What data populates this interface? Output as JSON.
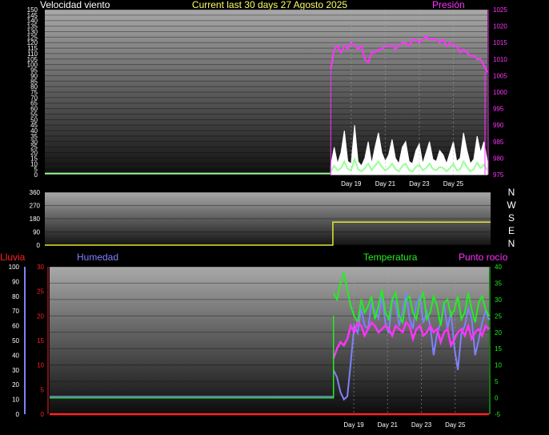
{
  "header": {
    "wind_label": "Velocidad viento",
    "title": "Current last 30 days 27 Agosto 2025",
    "pressure_label": "Presión"
  },
  "colors": {
    "wind_label": "#ffffff",
    "title": "#ffff66",
    "pressure": "#ff33ff",
    "wind_gust": "#ffffff",
    "wind_avg": "#99ff99",
    "wind_dir": "#e6e633",
    "rain": "#ff2222",
    "humidity": "#8080ff",
    "temperature": "#22ee22",
    "dew_point": "#ff33ff"
  },
  "compass_letters": [
    "N",
    "W",
    "S",
    "E",
    "N"
  ],
  "bottom_labels": {
    "rain": "Lluvia",
    "humidity": "Humedad",
    "temperature": "Temperatura",
    "dew_point": "Punto rocío"
  },
  "chart_data": [
    {
      "type": "line",
      "x_range": [
        "Day 1",
        "Day 27"
      ],
      "x_ticks": [
        "Day 19",
        "Day 21",
        "Day 23",
        "Day 25"
      ],
      "x_tick_days": [
        19,
        21,
        23,
        25
      ],
      "left_axis": {
        "ticks": [
          0,
          5,
          10,
          15,
          20,
          25,
          30,
          35,
          40,
          45,
          50,
          55,
          60,
          65,
          70,
          75,
          80,
          85,
          90,
          95,
          100,
          105,
          110,
          115,
          120,
          125,
          130,
          135,
          140,
          145,
          150
        ],
        "range": [
          0,
          150
        ]
      },
      "right_axis": {
        "ticks": [
          975,
          980,
          985,
          990,
          995,
          1000,
          1005,
          1010,
          1015,
          1020,
          1025
        ],
        "range": [
          975,
          1025
        ]
      },
      "series": [
        {
          "name": "Presión",
          "axis": "right",
          "start_day": 17.8,
          "values": [
            1007,
            1013,
            1014,
            1012,
            1014,
            1013,
            1015,
            1014,
            1013,
            1014,
            1010,
            1009,
            1012,
            1012,
            1013,
            1013,
            1014,
            1014,
            1014,
            1013,
            1014,
            1015,
            1015,
            1014,
            1016,
            1016,
            1015,
            1016,
            1017,
            1016,
            1016,
            1016,
            1015,
            1016,
            1014,
            1015,
            1014,
            1014,
            1012,
            1013,
            1012,
            1011,
            1011,
            1010,
            1010,
            1008,
            1006
          ]
        },
        {
          "axis": "left",
          "start_day": 17.8,
          "values": [
            8,
            25,
            10,
            20,
            40,
            12,
            10,
            45,
            12,
            8,
            15,
            30,
            10,
            25,
            38,
            20,
            12,
            18,
            32,
            15,
            10,
            25,
            30,
            12,
            10,
            22,
            28,
            10,
            20,
            30,
            14,
            12,
            22,
            18,
            10,
            20,
            30,
            12,
            15,
            38,
            22,
            10,
            14,
            35,
            20,
            30,
            12
          ]
        },
        {
          "axis": "left",
          "start_day": 17.8,
          "values": [
            3,
            8,
            4,
            6,
            12,
            5,
            4,
            14,
            5,
            3,
            6,
            10,
            4,
            8,
            12,
            7,
            4,
            6,
            10,
            5,
            3,
            8,
            10,
            4,
            3,
            7,
            9,
            4,
            6,
            10,
            5,
            4,
            7,
            6,
            3,
            6,
            10,
            4,
            5,
            12,
            7,
            3,
            5,
            11,
            6,
            9,
            4
          ]
        }
      ]
    },
    {
      "type": "line",
      "x_range": [
        "Day 1",
        "Day 27"
      ],
      "y_ticks": [
        0,
        90,
        180,
        270,
        360
      ],
      "ylim": [
        0,
        360
      ],
      "series": [
        {
          "axis": "left",
          "points": [
            [
              1,
              0
            ],
            [
              17.8,
              0
            ],
            [
              17.8,
              157
            ],
            [
              27,
              157
            ]
          ]
        }
      ]
    },
    {
      "type": "line",
      "x_range": [
        "Day 1",
        "Day 27"
      ],
      "x_ticks": [
        "Day 19",
        "Day 21",
        "Day 23",
        "Day 25"
      ],
      "x_tick_days": [
        19,
        21,
        23,
        25
      ],
      "humidity_axis": {
        "ticks": [
          0,
          10,
          20,
          30,
          40,
          50,
          60,
          70,
          80,
          90,
          100
        ],
        "range": [
          0,
          100
        ]
      },
      "rain_axis": {
        "ticks": [
          0,
          5,
          10,
          15,
          20,
          25,
          30
        ],
        "range": [
          0,
          30
        ]
      },
      "temperature_axis": {
        "ticks": [
          -5,
          0,
          5,
          10,
          15,
          20,
          25,
          30,
          35,
          40
        ],
        "range": [
          -5,
          40
        ]
      },
      "series": [
        {
          "name": "Lluvia",
          "axis": "rain",
          "points": [
            [
              1,
              0
            ],
            [
              27,
              0
            ]
          ]
        },
        {
          "name": "Humedad",
          "axis": "humidity",
          "start_day": 17.8,
          "values": [
            30,
            25,
            15,
            10,
            12,
            35,
            60,
            55,
            72,
            60,
            58,
            75,
            70,
            65,
            80,
            62,
            55,
            78,
            75,
            60,
            70,
            82,
            65,
            58,
            75,
            80,
            62,
            70,
            60,
            40,
            55,
            62,
            75,
            58,
            70,
            45,
            30,
            55,
            60,
            72,
            65,
            40,
            50,
            62,
            70,
            64
          ]
        },
        {
          "name": "Temperatura",
          "axis": "temperature",
          "start_day": 17.8,
          "values": [
            32,
            30,
            35,
            38,
            33,
            28,
            25,
            23,
            30,
            26,
            28,
            31,
            24,
            28,
            33,
            26,
            24,
            30,
            32,
            25,
            23,
            30,
            31,
            26,
            24,
            30,
            32,
            24,
            26,
            31,
            28,
            22,
            29,
            30,
            25,
            27,
            31,
            24,
            26,
            32,
            27,
            23,
            29,
            31,
            27,
            25
          ]
        },
        {
          "name": "Punto rocío",
          "axis": "temperature",
          "start_day": 17.8,
          "values": [
            12,
            15,
            17,
            16,
            18,
            22,
            20,
            23,
            22,
            19,
            21,
            23,
            22,
            20,
            21,
            22,
            21,
            19,
            22,
            21,
            20,
            23,
            22,
            18,
            21,
            22,
            19,
            20,
            22,
            20,
            21,
            17,
            20,
            21,
            16,
            18,
            20,
            21,
            19,
            22,
            18,
            20,
            21,
            19,
            22,
            21
          ]
        },
        {
          "axis": "temperature",
          "points": [
            [
              1,
              0
            ],
            [
              17.8,
              0
            ],
            [
              17.8,
              25
            ]
          ]
        },
        {
          "axis": "humidity",
          "points": [
            [
              1,
              12
            ],
            [
              17.8,
              12
            ]
          ]
        }
      ]
    }
  ]
}
